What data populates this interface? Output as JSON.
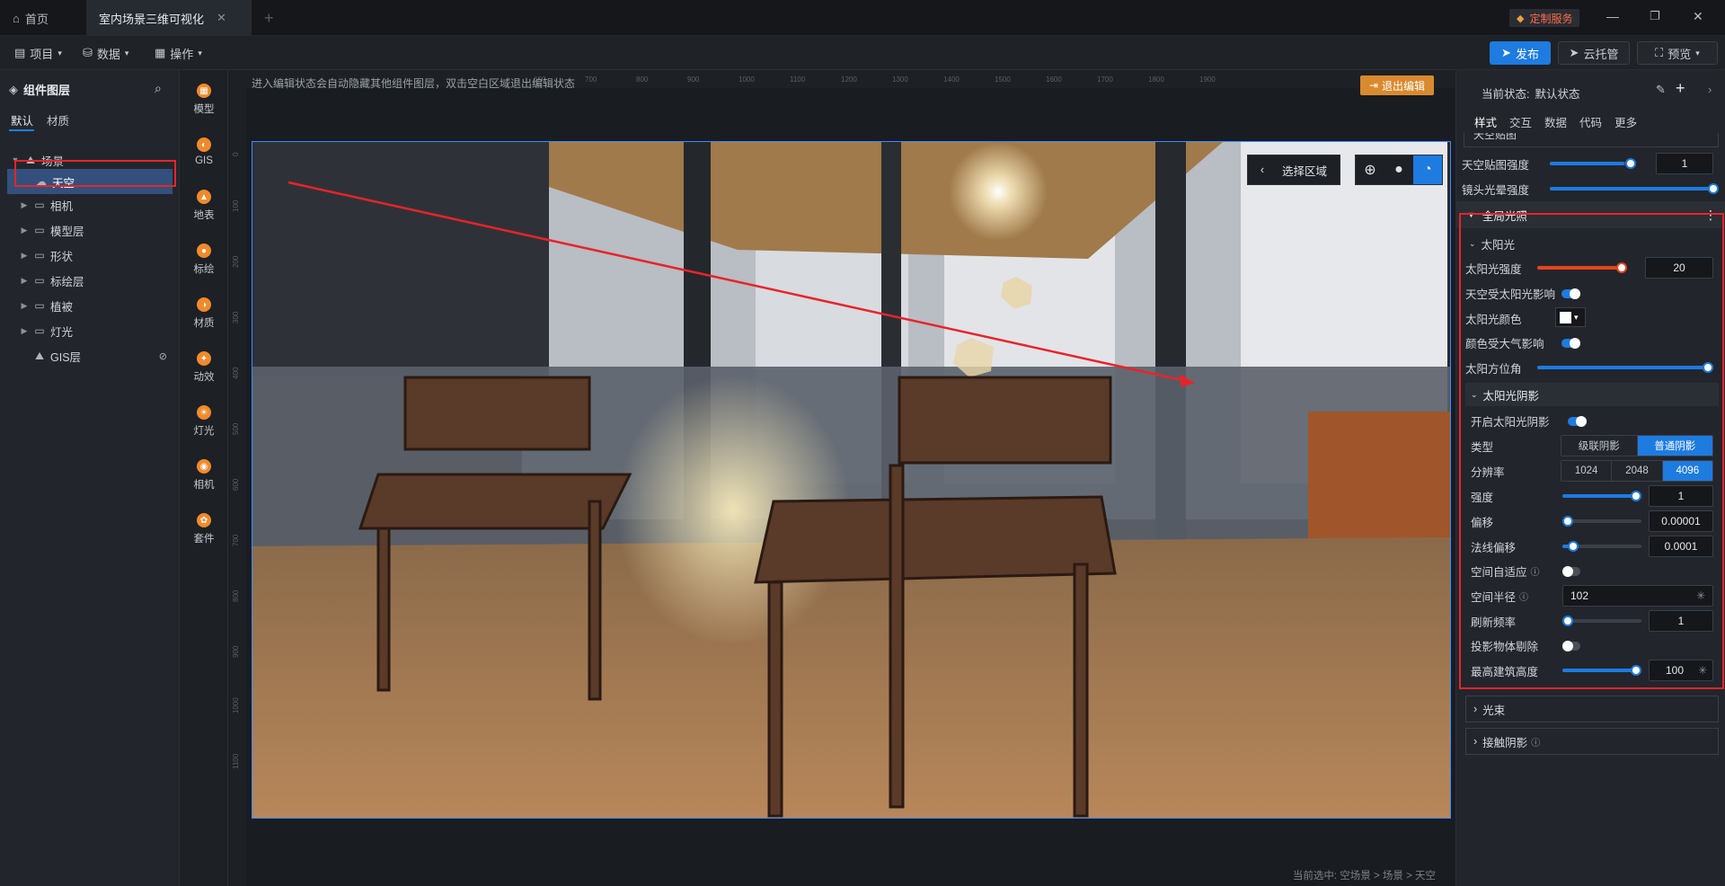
{
  "titlebar": {
    "tabs": [
      {
        "label": "首页",
        "icon": "home-icon"
      },
      {
        "label": "室内场景三维可视化",
        "icon": "close-icon"
      }
    ],
    "add_tab": "+",
    "custom_service": "定制服务",
    "window_controls": [
      "minimize-icon",
      "restore-icon",
      "close-icon"
    ]
  },
  "toolbar": {
    "menus": [
      "项目",
      "数据",
      "操作"
    ],
    "publish": "发布",
    "cloud": "云托管",
    "preview": "预览"
  },
  "left_panel": {
    "title": "组件图层",
    "tabs": [
      "默认",
      "材质"
    ],
    "tree": [
      {
        "label": "场景",
        "level": 0,
        "expanded": true,
        "icon": "scene-icon"
      },
      {
        "label": "天空",
        "level": 1,
        "selected": true,
        "icon": "sky-icon"
      },
      {
        "label": "相机",
        "level": 1,
        "icon": "folder-icon"
      },
      {
        "label": "模型层",
        "level": 1,
        "icon": "folder-icon"
      },
      {
        "label": "形状",
        "level": 1,
        "icon": "folder-icon"
      },
      {
        "label": "标绘层",
        "level": 1,
        "icon": "folder-icon"
      },
      {
        "label": "植被",
        "level": 1,
        "icon": "folder-icon"
      },
      {
        "label": "灯光",
        "level": 1,
        "icon": "folder-icon"
      },
      {
        "label": "GIS层",
        "level": 1,
        "icon": "gis-icon"
      }
    ]
  },
  "icon_bar": [
    {
      "label": "模型",
      "icon": "model-icon"
    },
    {
      "label": "GIS",
      "icon": "gis-icon"
    },
    {
      "label": "地表",
      "icon": "terrain-icon"
    },
    {
      "label": "标绘",
      "icon": "marker-icon"
    },
    {
      "label": "材质",
      "icon": "material-icon"
    },
    {
      "label": "动效",
      "icon": "effect-icon"
    },
    {
      "label": "灯光",
      "icon": "light-icon"
    },
    {
      "label": "相机",
      "icon": "camera-icon"
    },
    {
      "label": "套件",
      "icon": "kit-icon"
    }
  ],
  "canvas": {
    "hint": "进入编辑状态会自动隐藏其他组件图层，双击空白区域退出编辑状态",
    "exit_edit": "退出编辑",
    "select_area": "选择区域",
    "breadcrumb": "当前选中: 空场景 > 场景 > 天空",
    "ruler_top": [
      "600",
      "700",
      "800",
      "900",
      "1000",
      "1100",
      "1200",
      "1300",
      "1400",
      "1500",
      "1600",
      "1700",
      "1800",
      "1900"
    ],
    "ruler_left": [
      "0",
      "100",
      "200",
      "300",
      "400",
      "500",
      "600",
      "700",
      "800",
      "900",
      "1000",
      "1100"
    ]
  },
  "right_panel": {
    "state_label": "当前状态:",
    "state_value": "默认状态",
    "tabs": [
      "样式",
      "交互",
      "数据",
      "代码",
      "更多"
    ],
    "collapsed_top": "天空贴图",
    "sky_map_strength": {
      "label": "天空贴图强度",
      "value": "1",
      "fraction": 0.9
    },
    "lens_flare": {
      "label": "镜头光晕强度",
      "fraction": 1.0
    },
    "global_light": "全局光照",
    "sunlight": {
      "title": "太阳光",
      "intensity": {
        "label": "太阳光强度",
        "value": "20",
        "fraction": 1.0
      },
      "sky_affected": {
        "label": "天空受太阳光影响",
        "on": true
      },
      "color": {
        "label": "太阳光颜色",
        "value": "#ffffff"
      },
      "atmosphere": {
        "label": "颜色受大气影响",
        "on": true
      },
      "azimuth": {
        "label": "太阳方位角",
        "fraction": 1.0
      }
    },
    "shadow": {
      "title": "太阳光阴影",
      "enable": {
        "label": "开启太阳光阴影",
        "on": true
      },
      "type": {
        "label": "类型",
        "options": [
          "级联阴影",
          "普通阴影"
        ],
        "selected": 1
      },
      "resolution": {
        "label": "分辨率",
        "options": [
          "1024",
          "2048",
          "4096"
        ],
        "selected": 2
      },
      "strength": {
        "label": "强度",
        "value": "1",
        "fraction": 1.0
      },
      "bias": {
        "label": "偏移",
        "value": "0.00001",
        "fraction": 0.0
      },
      "normal_bias": {
        "label": "法线偏移",
        "value": "0.0001",
        "fraction": 0.1
      },
      "adaptive": {
        "label": "空间自适应",
        "on": false
      },
      "radius": {
        "label": "空间半径",
        "value": "102"
      },
      "refresh": {
        "label": "刷新频率",
        "value": "1",
        "fraction": 0.0
      },
      "cull": {
        "label": "投影物体剔除",
        "on": false
      },
      "max_height": {
        "label": "最高建筑高度",
        "value": "100",
        "fraction": 1.0
      }
    },
    "beam": "光束",
    "contact_shadow": "接触阴影"
  },
  "colors": {
    "accent": "#1e7be0",
    "orange": "#d98a2e",
    "highlight": "#e8242a"
  }
}
